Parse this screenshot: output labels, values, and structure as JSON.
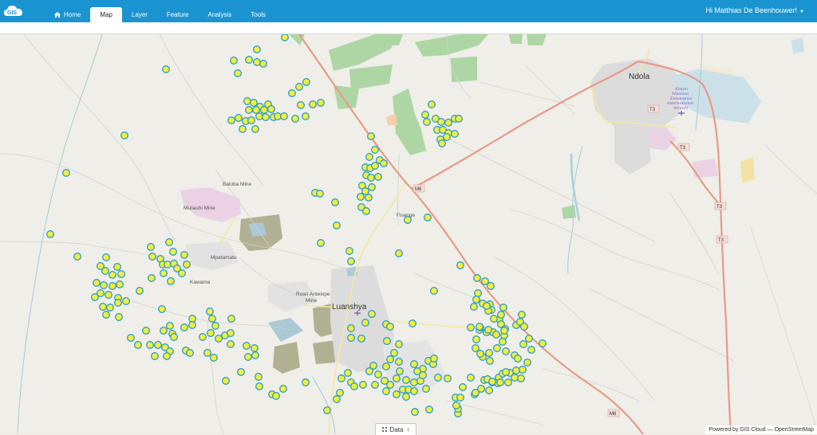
{
  "app": {
    "logo_text": "GIS"
  },
  "nav": {
    "items": [
      {
        "label": "Home",
        "icon": "home-icon",
        "active": false
      },
      {
        "label": "Map",
        "active": true
      },
      {
        "label": "Layer",
        "active": false
      },
      {
        "label": "Feature",
        "active": false
      },
      {
        "label": "Analysis",
        "active": false
      },
      {
        "label": "Tools",
        "active": false
      }
    ]
  },
  "user": {
    "greeting": "Hi Matthias De Beenhouwer!"
  },
  "map": {
    "places": {
      "baluba_mine": "Baluba Mine",
      "muliashi_mine": "Muliashi Mine",
      "mpatamatu": "Mpatamatu",
      "kawama": "Kawama",
      "roan_antelope_1": "Roan Antelope",
      "roan_antelope_2": "Mine",
      "luanshya": "Luanshya",
      "fisenge": "Fisenge",
      "ndola": "Ndola",
      "airport_1": "Simon",
      "airport_2": "Mwansa",
      "airport_3": "Kapwepwe",
      "airport_4": "International",
      "airport_5": "Airport"
    },
    "roads": {
      "m6": "M6",
      "t3": "T3"
    },
    "marker_color_fill": "#f2ef3a",
    "marker_color_stroke": "#2a9bd4"
  },
  "data_tab": {
    "label": "Data"
  },
  "attribution": "Powered by GIS Cloud — OpenStreetMap"
}
